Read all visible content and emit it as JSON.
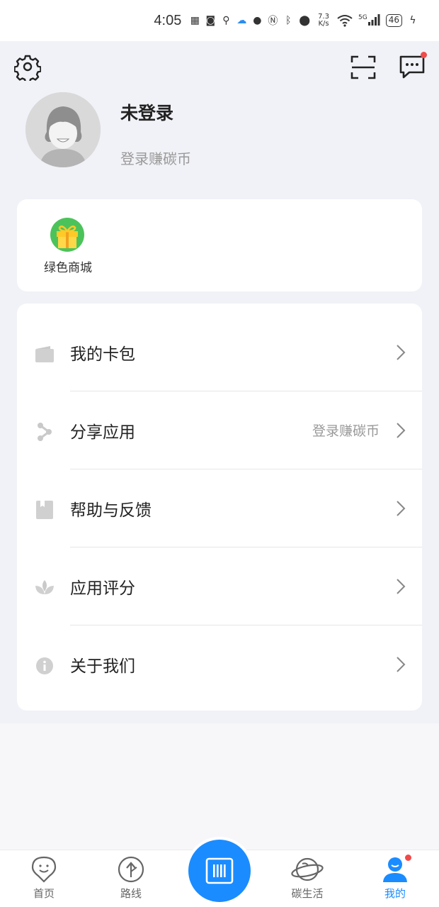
{
  "status_bar": {
    "time": "4:05",
    "speed_top": "7.3",
    "speed_bottom": "K/s",
    "network": "5G",
    "battery": "46"
  },
  "profile": {
    "username": "未登录",
    "login_hint": "登录赚碳币"
  },
  "shop": {
    "label": "绿色商城"
  },
  "menu": {
    "items": [
      {
        "label": "我的卡包",
        "extra": ""
      },
      {
        "label": "分享应用",
        "extra": "登录赚碳币"
      },
      {
        "label": "帮助与反馈",
        "extra": ""
      },
      {
        "label": "应用评分",
        "extra": ""
      },
      {
        "label": "关于我们",
        "extra": ""
      }
    ]
  },
  "bottom_nav": {
    "items": [
      {
        "label": "首页",
        "icon": "home-pin-icon"
      },
      {
        "label": "路线",
        "icon": "route-arrow-icon"
      },
      {
        "label": "碳生活",
        "icon": "planet-icon"
      },
      {
        "label": "我的",
        "icon": "user-icon"
      }
    ],
    "center_icon": "barcode-scan-icon",
    "active_color": "#1a8cff"
  },
  "colors": {
    "accent": "#1a8cff",
    "badge": "#f04a4a",
    "background": "#f1f2f7"
  }
}
